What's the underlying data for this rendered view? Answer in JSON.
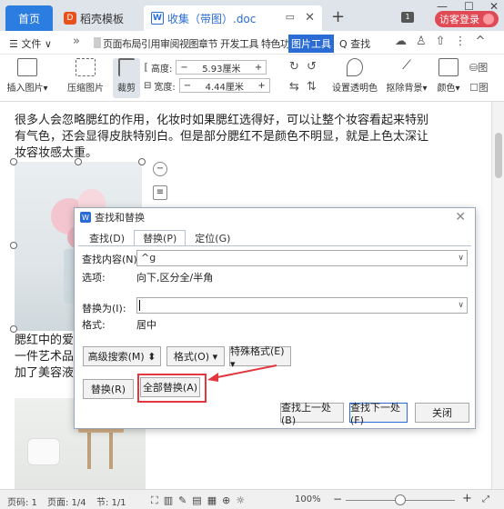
{
  "tabs": {
    "home": "首页",
    "template": "稻壳模板",
    "doc": "收集（带图）.doc",
    "add": "+",
    "login": "访客登录",
    "badge": "1"
  },
  "window_controls": {
    "min": "—",
    "max": "☐",
    "close": "✕"
  },
  "menu": {
    "file": "☰ 文件 ∨",
    "more": "»",
    "items": "页面布局引用审阅视图章节 开发工具 特色功能",
    "active": "图片工具",
    "search": "Q 查找"
  },
  "ribbon": {
    "insert_image": "插入图片",
    "compress_image": "压缩图片",
    "crop": "裁剪",
    "height_label": "高度:",
    "height_value": "5.93厘米",
    "width_label": "宽度:",
    "width_value": "4.44厘米",
    "transparent": "设置透明色",
    "remove_bg": "抠除背景",
    "color": "颜色",
    "minus": "−",
    "plus": "+"
  },
  "document": {
    "para1_line1": "很多人会忽略腮红的作用，化妆时如果腮红选得好，可以让整个妆容看起来特别",
    "para1_line2": "有气色，还会显得皮肤特别白。但是部分腮红不是颜色不明显，就是上色太深让",
    "para1_line3": "妆容妆感太重。",
    "para2_line1": "腮红中的爱",
    "para2_line2": "一件艺术品",
    "para2_line3": "加了美容液"
  },
  "dialog": {
    "title": "查找和替换",
    "close": "✕",
    "tabs": [
      "查找(D)",
      "替换(P)",
      "定位(G)"
    ],
    "active_tab": 1,
    "find_label": "查找内容(N):",
    "find_value": "^g",
    "options_label": "选项:",
    "options_value": "向下,区分全/半角",
    "replace_label": "替换为(I):",
    "replace_value": "",
    "format_label": "格式:",
    "format_value": "居中",
    "advanced_search": "高级搜索(M) ⬍",
    "format_btn": "格式(O) ▾",
    "special_btn": "特殊格式(E) ▾",
    "replace_btn": "替换(R)",
    "replace_all_btn": "全部替换(A)",
    "find_prev_btn": "查找上一处(B)",
    "find_next_btn": "查找下一处(F)",
    "close_btn": "关闭"
  },
  "status": {
    "page_no": "页码: 1",
    "page": "页面: 1/4",
    "section": "节: 1/1",
    "zoom": "100%",
    "zoom_minus": "−",
    "zoom_plus": "+"
  },
  "colors": {
    "accent": "#2b6cd4",
    "highlight": "#e0383e",
    "login": "#e04a55"
  }
}
